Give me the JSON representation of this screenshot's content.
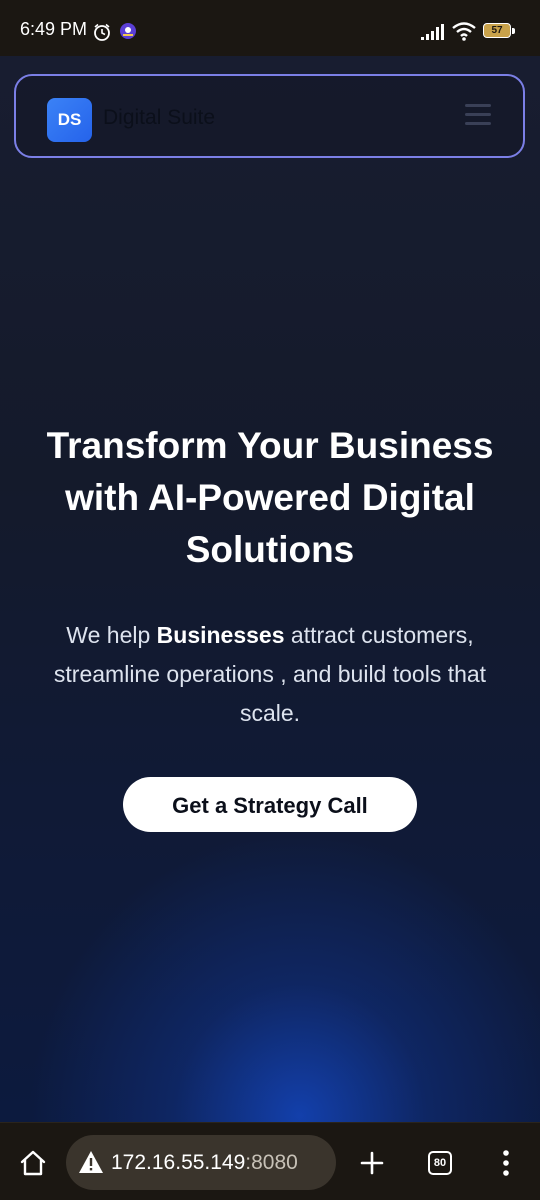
{
  "status_bar": {
    "time": "6:49 PM",
    "battery_level": "57",
    "icons": [
      "alarm-icon",
      "app-notification-icon",
      "signal-icon",
      "wifi-icon",
      "battery-icon"
    ]
  },
  "navbar": {
    "logo_text": "DS",
    "brand_name": "Digital Suite",
    "menu_icon": "hamburger-menu-icon"
  },
  "hero": {
    "title": "Transform Your Business with AI-Powered Digital Solutions",
    "subtitle_prefix": "We help ",
    "subtitle_bold": "Businesses",
    "subtitle_suffix": " attract customers, streamline operations , and build tools that scale.",
    "cta_label": "Get a Strategy Call"
  },
  "browser_bar": {
    "url_host": "172.16.55.149",
    "url_port": ":8080",
    "tab_count": "80",
    "icons": [
      "home-icon",
      "not-secure-warning-icon",
      "new-tab-plus-icon",
      "tab-switcher-icon",
      "more-options-icon"
    ]
  },
  "colors": {
    "accent_border": "#7b7fe6",
    "logo_blue": "#2563eb",
    "page_background": "#141a2b",
    "cta_background": "#ffffff"
  }
}
